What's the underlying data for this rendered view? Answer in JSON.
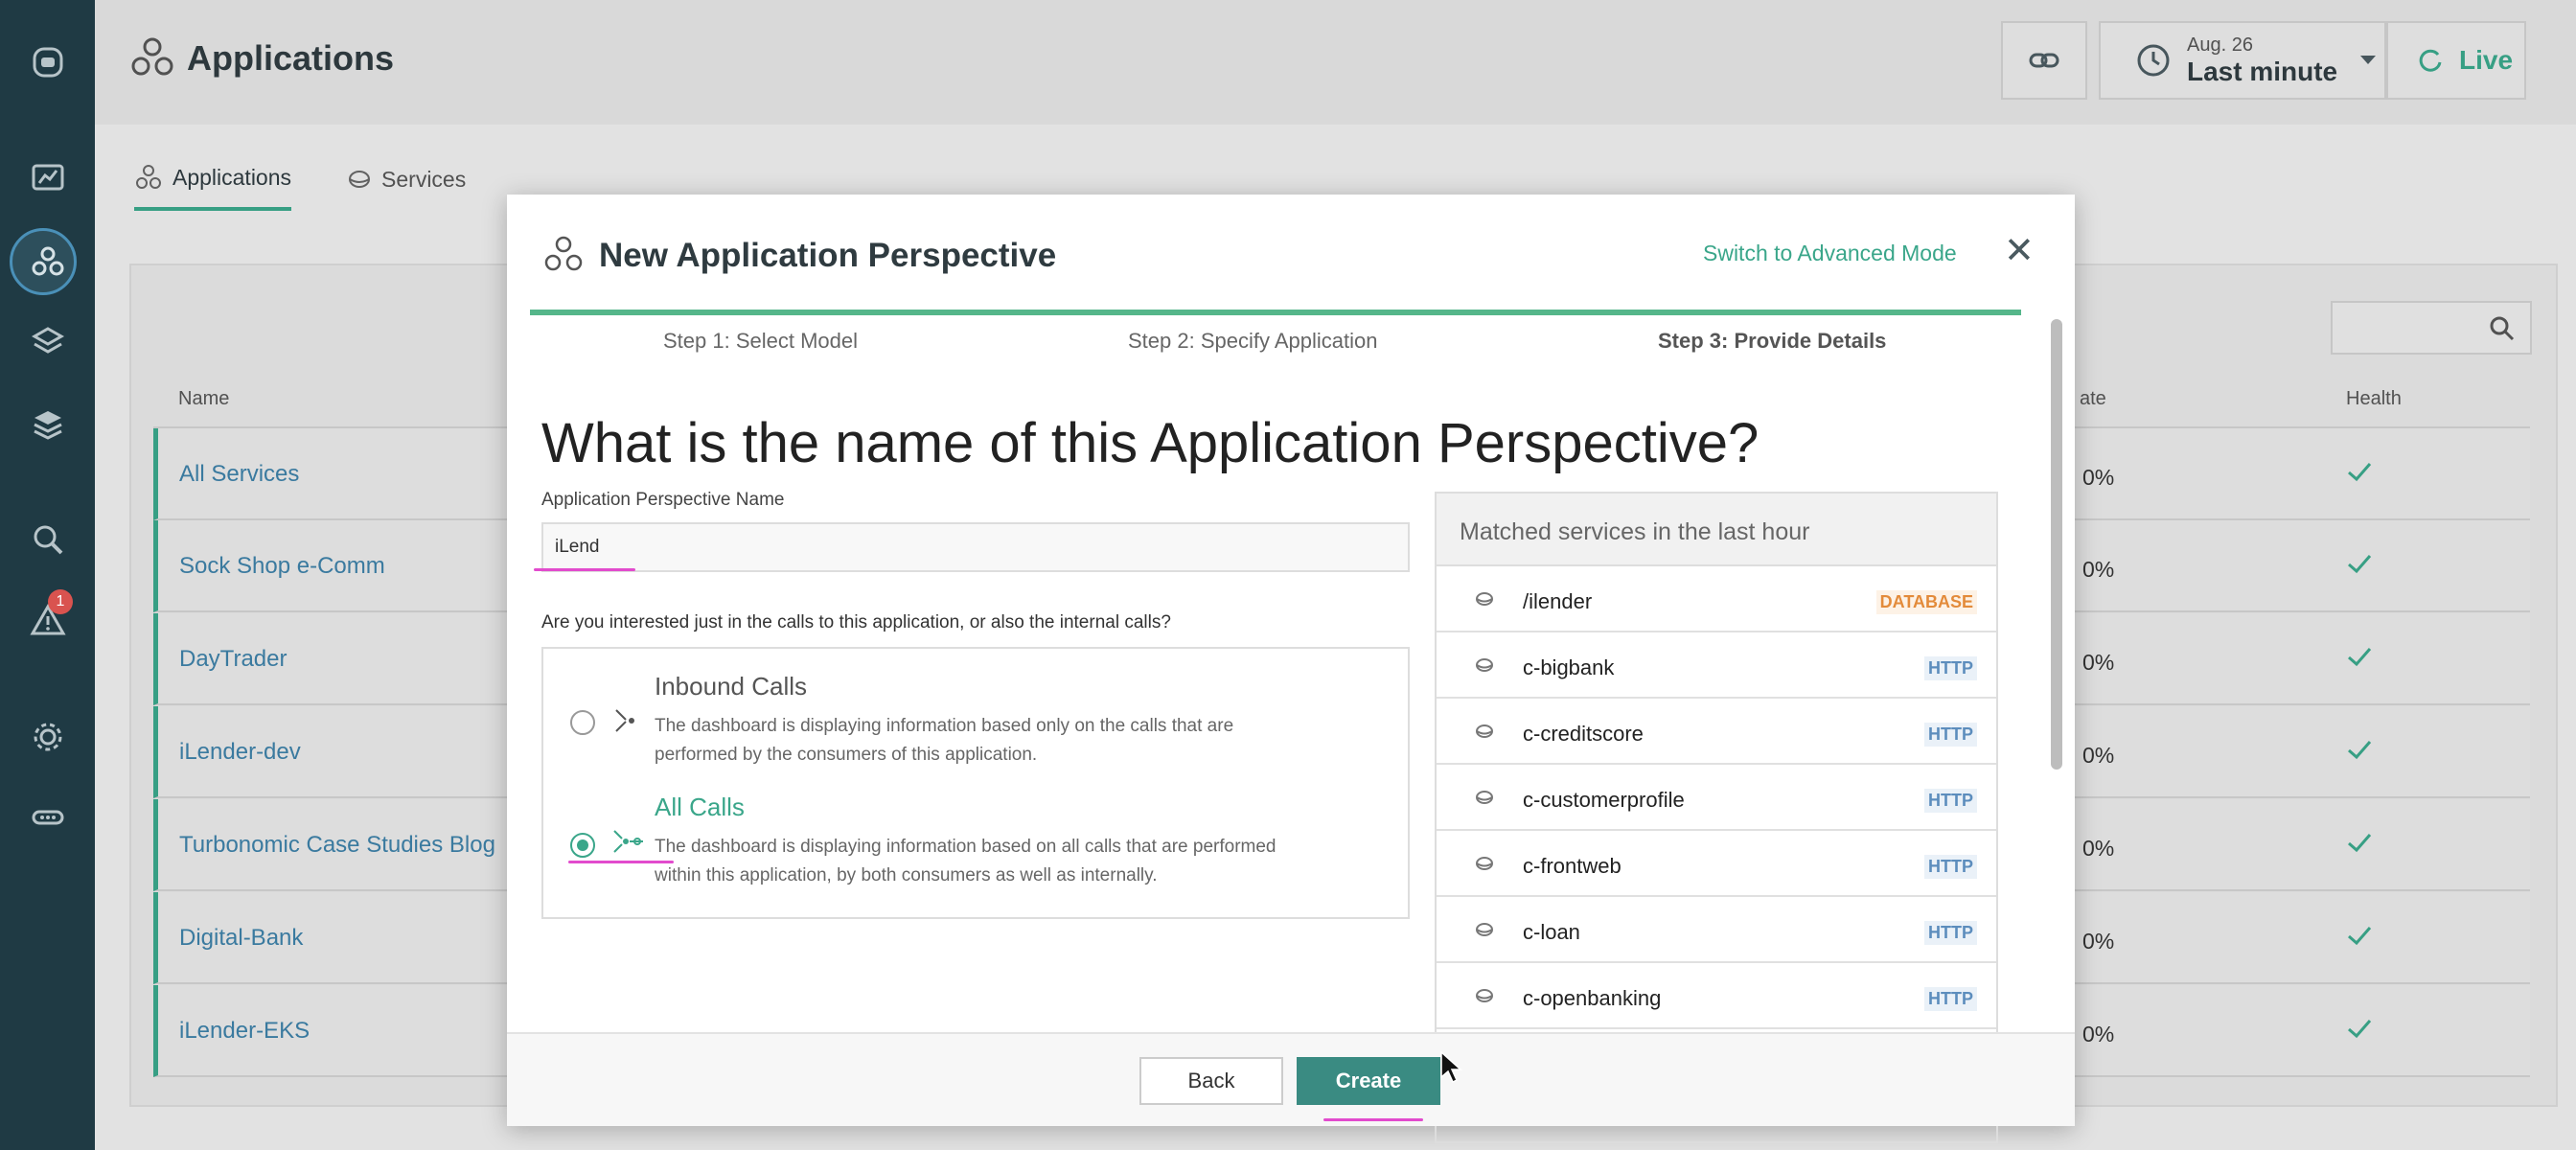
{
  "rail": {
    "icons": [
      "robot-logo-icon",
      "dashboard-icon",
      "applications-icon",
      "websites-icon",
      "infrastructure-icon",
      "analyze-icon",
      "alert-icon",
      "settings-icon",
      "more-icon"
    ],
    "alert_count": "1"
  },
  "header": {
    "title": "Applications",
    "time_date": "Aug. 26",
    "time_label": "Last minute",
    "live_label": "Live"
  },
  "tabs": [
    {
      "label": "Applications",
      "icon": "applications-icon"
    },
    {
      "label": "Services",
      "icon": "service-icon"
    }
  ],
  "table": {
    "col_name": "Name",
    "col_rate": "ate",
    "col_health": "Health",
    "rows": [
      {
        "name": "All Services",
        "rate": "0%"
      },
      {
        "name": "Sock Shop e-Comm",
        "rate": "0%"
      },
      {
        "name": "DayTrader",
        "rate": "0%"
      },
      {
        "name": "iLender-dev",
        "rate": "0%"
      },
      {
        "name": "Turbonomic Case Studies Blog",
        "rate": "0%"
      },
      {
        "name": "Digital-Bank",
        "rate": "0%"
      },
      {
        "name": "iLender-EKS",
        "rate": "0%"
      }
    ]
  },
  "modal": {
    "title": "New Application Perspective",
    "advanced_link": "Switch to Advanced Mode",
    "close": "✕",
    "steps": [
      "Step 1: Select Model",
      "Step 2: Specify Application",
      "Step 3: Provide Details"
    ],
    "question": "What is the name of this Application Perspective?",
    "name_label": "Application Perspective Name",
    "name_value": "iLend",
    "calls_question": "Are you interested just in the calls to this application, or also the internal calls?",
    "options": [
      {
        "title": "Inbound Calls",
        "desc": "The dashboard is displaying information based only on the calls that are performed by the consumers of this application.",
        "selected": false
      },
      {
        "title": "All Calls",
        "desc": "The dashboard is displaying information based on all calls that are performed within this application, by both consumers as well as internally.",
        "selected": true
      }
    ],
    "matched_title": "Matched services in the last hour",
    "services": [
      {
        "name": "/ilender",
        "type": "DATABASE"
      },
      {
        "name": "c-bigbank",
        "type": "HTTP"
      },
      {
        "name": "c-creditscore",
        "type": "HTTP"
      },
      {
        "name": "c-customerprofile",
        "type": "HTTP"
      },
      {
        "name": "c-frontweb",
        "type": "HTTP"
      },
      {
        "name": "c-loan",
        "type": "HTTP"
      },
      {
        "name": "c-openbanking",
        "type": "HTTP"
      }
    ],
    "back_label": "Back",
    "create_label": "Create"
  },
  "colors": {
    "accent": "#3aa68a",
    "rail": "#1f3a44",
    "link": "#3d7fa6",
    "annotation": "#e24bcd"
  }
}
